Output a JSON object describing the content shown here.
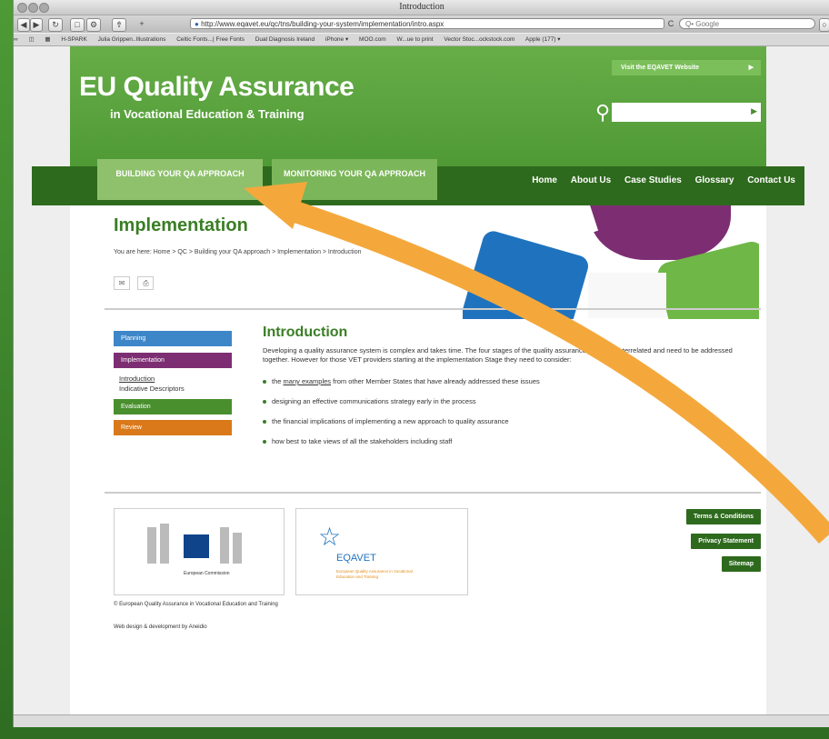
{
  "window": {
    "title": "Introduction"
  },
  "toolbar": {
    "url": "http://www.eqavet.eu/qc/tns/building-your-system/implementation/intro.aspx",
    "search_placeholder": "Q• Google",
    "reload_icon": "C"
  },
  "bookmarks": [
    "H-SPARK",
    "Julia Grippen..Illustrations",
    "Celtic Fonts...| Free Fonts",
    "Dual Diagnosis Ireland",
    "iPhone ▾",
    "MOO.com",
    "W...ue to print",
    "Vector Stoc...ockstock.com",
    "Apple (177) ▾"
  ],
  "header": {
    "brand_title": "EU Quality Assurance",
    "brand_subtitle": "in Vocational Education & Training",
    "visit_label": "Visit the EQAVET Website",
    "search_placeholder": ""
  },
  "nav": {
    "tab1": "BUILDING YOUR QA APPROACH",
    "tab2": "MONITORING YOUR QA APPROACH",
    "links": [
      "Home",
      "About Us",
      "Case Studies",
      "Glossary",
      "Contact Us"
    ]
  },
  "page": {
    "title": "Implementation",
    "breadcrumb": "You are here: Home > QC > Building your QA approach > Implementation > Introduction"
  },
  "leftnav": {
    "planning": "Planning",
    "implementation": "Implementation",
    "sub_intro": "Introduction",
    "sub_indicative": "Indicative Descriptors",
    "evaluation": "Evaluation",
    "review": "Review"
  },
  "content": {
    "title": "Introduction",
    "intro": "Developing a quality assurance system is complex and takes time. The four stages of the quality assurance cycle are interrelated and need to be addressed together. However for those VET providers starting at the implementation Stage they need to consider:",
    "b1_link": "many examples",
    "b1_prefix": "the",
    "b1_rest": "from other Member States that have already addressed these issues",
    "b2": "designing an effective communications strategy early in the process",
    "b3": "the financial implications of implementing a new approach to quality assurance",
    "b4": "how best to take views of all the stakeholders including staff"
  },
  "footer": {
    "ec_label": "European Commission",
    "eqavet_name": "EQAVET",
    "eqavet_sub": "European Quality Assurance in Vocational Education and Training",
    "terms": "Terms & Conditions",
    "privacy": "Privacy Statement",
    "sitemap": "Sitemap",
    "copyright": "© European Quality Assurance in Vocational Education and Training",
    "credit": "Web design & development by Aneidio"
  },
  "colors": {
    "brand_green": "#4f9a35",
    "dark_green": "#2e6a1d",
    "blue": "#1f73be",
    "purple": "#7d2e73",
    "orange": "#d9791a",
    "arrow": "#f4a83c"
  }
}
